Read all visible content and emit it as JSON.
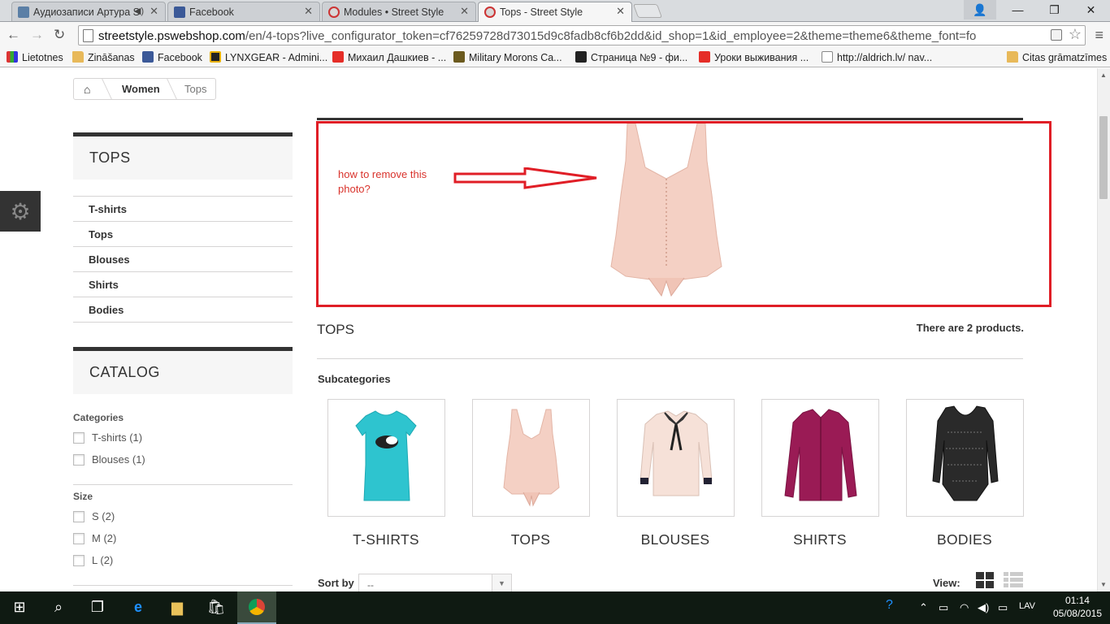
{
  "browser": {
    "tabs": [
      {
        "label": "Аудиозаписи Артура S",
        "active": false
      },
      {
        "label": "Facebook",
        "active": false
      },
      {
        "label": "Modules • Street Style",
        "active": false
      },
      {
        "label": "Tops - Street Style",
        "active": true
      }
    ],
    "url_host": "streetstyle.pswebshop.com",
    "url_path": "/en/4-tops?live_configurator_token=cf76259728d73015d9c8fadb8cf6b2dd&id_shop=1&id_employee=2&theme=theme6&theme_font=fo",
    "bookmarks": [
      "Lietotnes",
      "Zināšanas",
      "Facebook",
      "LYNXGEAR - Admini...",
      "Михаил Дашкиев - ...",
      "Military Morons Ca...",
      "Страница №9 - фи...",
      "Уроки выживания ...",
      "http://aldrich.lv/ nav...",
      "Citas grāmatzīmes"
    ]
  },
  "breadcrumb": {
    "level1": "Women",
    "level2": "Tops"
  },
  "sidebar": {
    "block_title": "TOPS",
    "categories": [
      "T-shirts",
      "Tops",
      "Blouses",
      "Shirts",
      "Bodies"
    ],
    "catalog_title": "CATALOG",
    "filter_categories_label": "Categories",
    "filter_categories": [
      "T-shirts (1)",
      "Blouses (1)"
    ],
    "filter_size_label": "Size",
    "filter_sizes": [
      "S (2)",
      "M (2)",
      "L (2)"
    ]
  },
  "annotation": {
    "note": "how to remove this photo?",
    "color": "#e01e26"
  },
  "main": {
    "title": "TOPS",
    "product_count": "There are 2 products.",
    "subcategories_label": "Subcategories",
    "subcategories": [
      "T-SHIRTS",
      "TOPS",
      "BLOUSES",
      "SHIRTS",
      "BODIES"
    ],
    "sort_label": "Sort by",
    "sort_value": "--",
    "view_label": "View:"
  },
  "taskbar": {
    "language": "LAV",
    "time": "01:14",
    "date": "05/08/2015"
  }
}
